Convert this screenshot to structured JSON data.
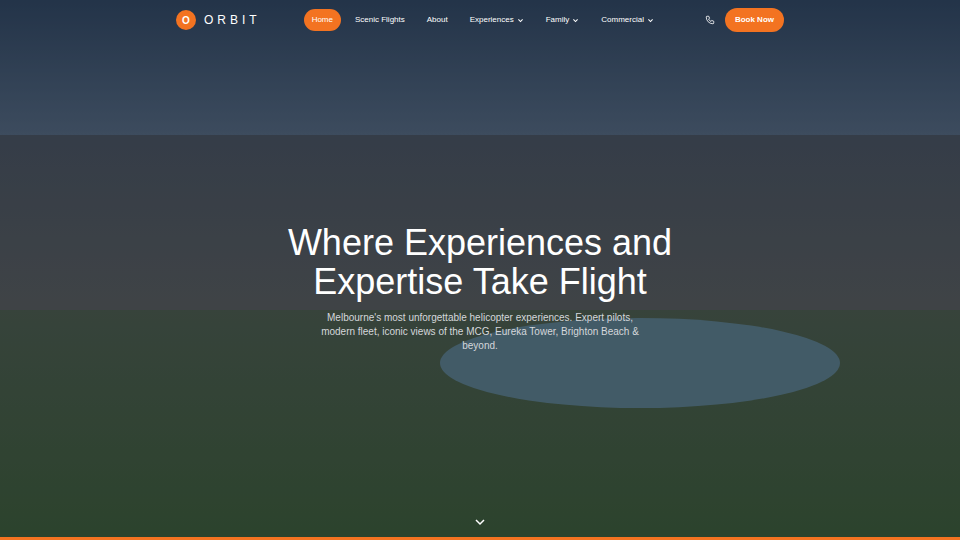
{
  "logo": {
    "mark": "O",
    "brand": "ORBIT"
  },
  "nav": [
    {
      "label": "Home",
      "selected": true,
      "has_menu": false
    },
    {
      "label": "Scenic Flights",
      "selected": false,
      "has_menu": false
    },
    {
      "label": "About",
      "selected": false,
      "has_menu": false
    },
    {
      "label": "Experiences",
      "selected": false,
      "has_menu": true
    },
    {
      "label": "Family",
      "selected": false,
      "has_menu": true
    },
    {
      "label": "Commercial",
      "selected": false,
      "has_menu": true
    }
  ],
  "cta": "Book Now",
  "hero": {
    "title": "Where Experiences and Expertise Take Flight",
    "subtitle": "Melbourne's most unforgettable helicopter experiences. Expert pilots, modern fleet, iconic views of the MCG, Eureka Tower, Brighton Beach & beyond."
  }
}
